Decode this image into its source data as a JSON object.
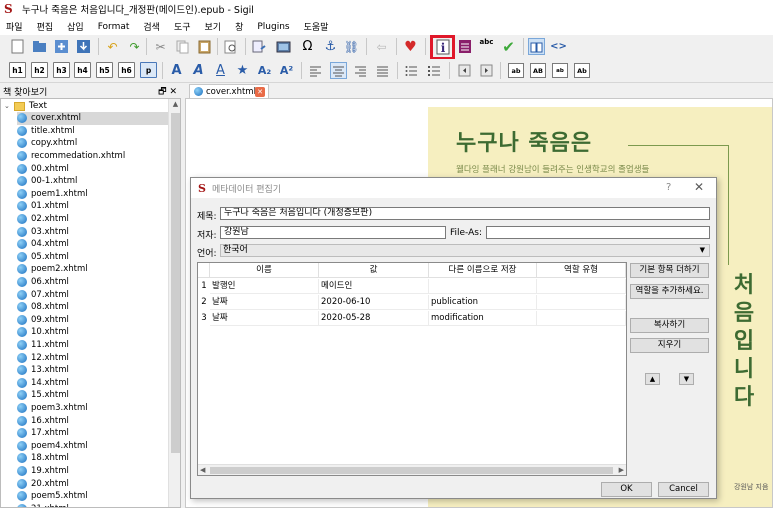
{
  "window": {
    "title": "누구나 죽음은 처음입니다_개정판(메이드인).epub - Sigil",
    "logo": "S"
  },
  "menu": [
    "파일",
    "편집",
    "삽입",
    "Format",
    "검색",
    "도구",
    "보기",
    "창",
    "Plugins",
    "도움말"
  ],
  "toolbar2": {
    "headings": [
      "h1",
      "h2",
      "h3",
      "h4",
      "h5",
      "h6",
      "p"
    ],
    "case_buttons": [
      "ab",
      "AB",
      "ab",
      "Ab"
    ]
  },
  "book_browser": {
    "title": "책 찾아보기",
    "controls": "🗗 ✕",
    "folder": "Text",
    "files": [
      "cover.xhtml",
      "title.xhtml",
      "copy.xhtml",
      "recommedation.xhtml",
      "00.xhtml",
      "00-1.xhtml",
      "poem1.xhtml",
      "01.xhtml",
      "02.xhtml",
      "03.xhtml",
      "04.xhtml",
      "05.xhtml",
      "poem2.xhtml",
      "06.xhtml",
      "07.xhtml",
      "08.xhtml",
      "09.xhtml",
      "10.xhtml",
      "11.xhtml",
      "12.xhtml",
      "13.xhtml",
      "14.xhtml",
      "15.xhtml",
      "poem3.xhtml",
      "16.xhtml",
      "17.xhtml",
      "poem4.xhtml",
      "18.xhtml",
      "19.xhtml",
      "20.xhtml",
      "poem5.xhtml",
      "21.xhtml"
    ],
    "selected_index": 0
  },
  "editor": {
    "tab_label": "cover.xhtml",
    "cover_title": "누구나 죽음은",
    "cover_subtitle": "웰다잉 플래너 강원남이 들려주는 인생학교의 졸업생들",
    "cover_vertical": "처음입니다",
    "cover_author": "강원남 지음"
  },
  "dialog": {
    "title": "메타데이터 편집기",
    "help": "?",
    "close": "✕",
    "title_label": "제목:",
    "title_value": "누구나 죽음은 처음입니다 (개정증보판)",
    "author_label": "저자:",
    "author_value": "강원남",
    "fileas_label": "File-As:",
    "fileas_value": "",
    "language_label": "언어:",
    "language_value": "한국어",
    "table": {
      "headers": [
        "이름",
        "값",
        "다른 이름으로 저장",
        "역할 유형"
      ],
      "rows": [
        {
          "num": "1",
          "name": "발행인",
          "value": "메이드인",
          "save_as": "",
          "role": ""
        },
        {
          "num": "2",
          "name": "날짜",
          "value": "2020-06-10",
          "save_as": "publication",
          "role": ""
        },
        {
          "num": "3",
          "name": "날짜",
          "value": "2020-05-28",
          "save_as": "modification",
          "role": ""
        }
      ]
    },
    "buttons": {
      "add_basic": "기본 항목 더하기",
      "add_role": "역할을 추가하세요.",
      "copy": "복사하기",
      "delete": "지우기",
      "move_up": "▲",
      "move_down": "▼",
      "ok": "OK",
      "cancel": "Cancel"
    }
  }
}
